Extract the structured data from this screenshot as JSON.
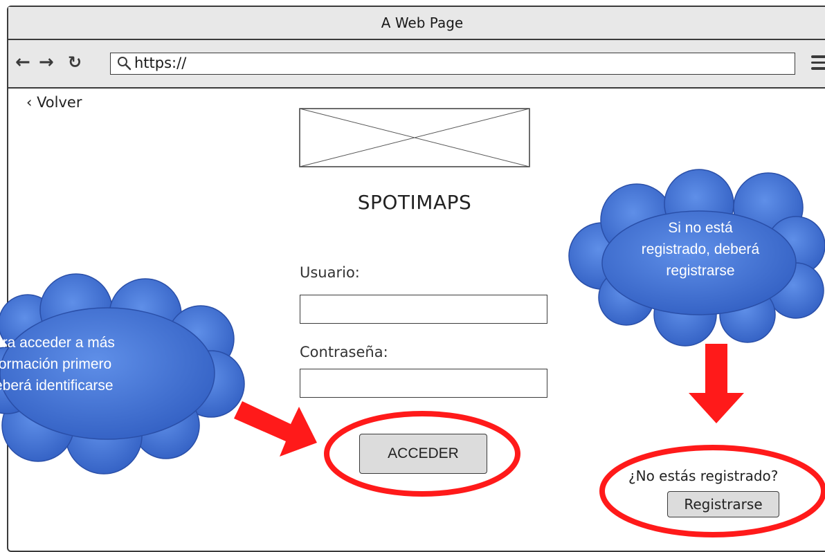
{
  "window": {
    "title": "A Web Page"
  },
  "browser": {
    "back_icon": "arrow-left-icon",
    "forward_icon": "arrow-right-icon",
    "reload_icon": "reload-icon",
    "url": "https://",
    "menu_icon": "hamburger-menu-icon"
  },
  "page": {
    "back_link": "‹ Volver",
    "app_title": "SPOTIMAPS",
    "username_label": "Usuario:",
    "username_value": "",
    "password_label": "Contraseña:",
    "password_value": "",
    "login_button": "ACCEDER",
    "not_registered_text": "¿No estás registrado?",
    "register_button": "Registrarse"
  },
  "annotations": {
    "left_cloud_lines": [
      "ara acceder a más",
      "formación primero",
      "eberá identificarse"
    ],
    "right_cloud_lines": [
      "Si no está",
      "registrado, deberá",
      "registrarse"
    ],
    "cloud_color": "#3e6fd0",
    "highlight_color": "#ff1a1a"
  }
}
